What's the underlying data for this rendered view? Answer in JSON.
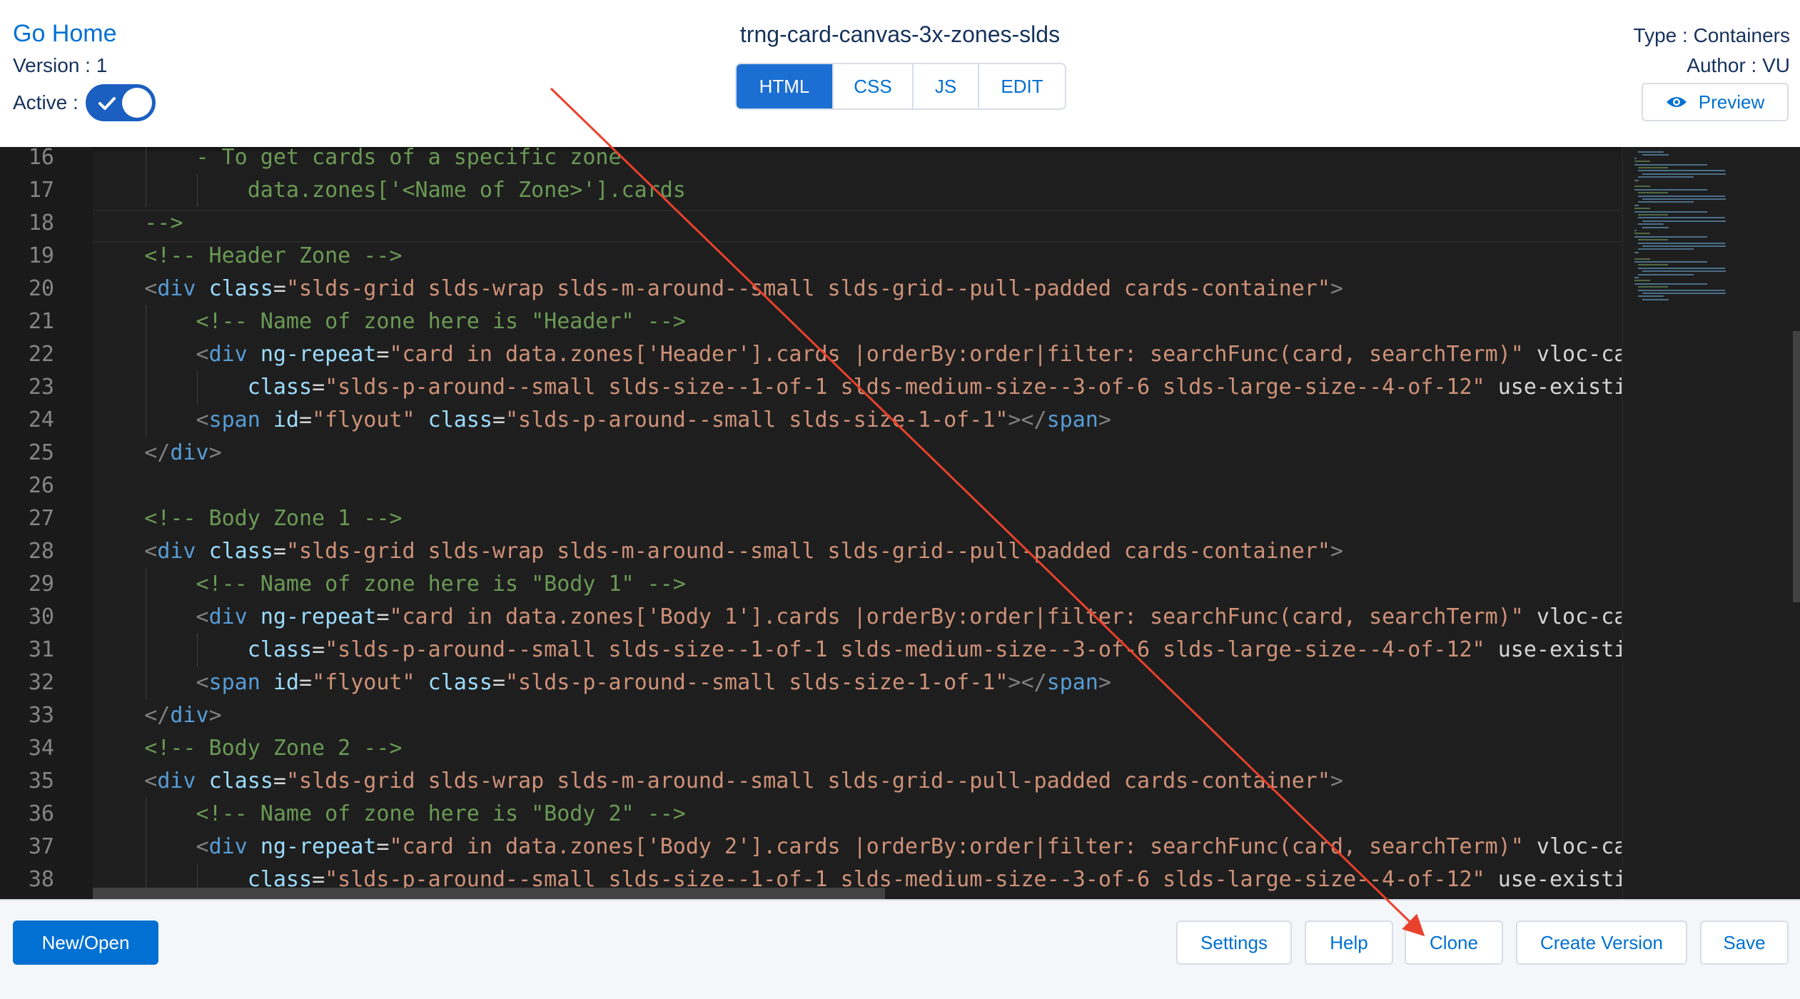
{
  "header": {
    "go_home": "Go Home",
    "version": "Version : 1",
    "active_label": "Active :",
    "active": true,
    "title": "trng-card-canvas-3x-zones-slds",
    "tabs": [
      {
        "label": "HTML",
        "selected": true
      },
      {
        "label": "CSS",
        "selected": false
      },
      {
        "label": "JS",
        "selected": false
      },
      {
        "label": "EDIT",
        "selected": false
      }
    ],
    "type": "Type : Containers",
    "author": "Author : VU",
    "preview_label": "Preview",
    "preview_icon": "eye-icon"
  },
  "editor": {
    "lines": [
      {
        "n": "16",
        "text": "        - To get cards of a specific zone"
      },
      {
        "n": "17",
        "text": "            data.zones['<Name of Zone>'].cards"
      },
      {
        "n": "18",
        "text": "    -->"
      },
      {
        "n": "19",
        "text": "    <!-- Header Zone -->"
      },
      {
        "n": "20",
        "text": "    <div class=\"slds-grid slds-wrap slds-m-around--small slds-grid--pull-padded cards-container\">"
      },
      {
        "n": "21",
        "text": "        <!-- Name of zone here is \"Header\" -->"
      },
      {
        "n": "22",
        "text": "        <div ng-repeat=\"card in data.zones['Header'].cards |orderBy:order|filter: searchFunc(card, searchTerm)\" vloc-ca"
      },
      {
        "n": "23",
        "text": "            class=\"slds-p-around--small slds-size--1-of-1 slds-medium-size--3-of-6 slds-large-size--4-of-12\" use-existi"
      },
      {
        "n": "24",
        "text": "        <span id=\"flyout\" class=\"slds-p-around--small slds-size-1-of-1\"></span>"
      },
      {
        "n": "25",
        "text": "    </div>"
      },
      {
        "n": "26",
        "text": ""
      },
      {
        "n": "27",
        "text": "    <!-- Body Zone 1 -->"
      },
      {
        "n": "28",
        "text": "    <div class=\"slds-grid slds-wrap slds-m-around--small slds-grid--pull-padded cards-container\">"
      },
      {
        "n": "29",
        "text": "        <!-- Name of zone here is \"Body 1\" -->"
      },
      {
        "n": "30",
        "text": "        <div ng-repeat=\"card in data.zones['Body 1'].cards |orderBy:order|filter: searchFunc(card, searchTerm)\" vloc-ca"
      },
      {
        "n": "31",
        "text": "            class=\"slds-p-around--small slds-size--1-of-1 slds-medium-size--3-of-6 slds-large-size--4-of-12\" use-existi"
      },
      {
        "n": "32",
        "text": "        <span id=\"flyout\" class=\"slds-p-around--small slds-size-1-of-1\"></span>"
      },
      {
        "n": "33",
        "text": "    </div>"
      },
      {
        "n": "34",
        "text": "    <!-- Body Zone 2 -->"
      },
      {
        "n": "35",
        "text": "    <div class=\"slds-grid slds-wrap slds-m-around--small slds-grid--pull-padded cards-container\">"
      },
      {
        "n": "36",
        "text": "        <!-- Name of zone here is \"Body 2\" -->"
      },
      {
        "n": "37",
        "text": "        <div ng-repeat=\"card in data.zones['Body 2'].cards |orderBy:order|filter: searchFunc(card, searchTerm)\" vloc-ca"
      },
      {
        "n": "38",
        "text": "            class=\"slds-p-around--small slds-size--1-of-1 slds-medium-size--3-of-6 slds-large-size--4-of-12\" use-existi"
      }
    ]
  },
  "footer": {
    "new_open": "New/Open",
    "settings": "Settings",
    "help": "Help",
    "clone": "Clone",
    "create_version": "Create Version",
    "save": "Save"
  },
  "colors": {
    "brand": "#0070d2",
    "editor_bg": "#1e1e1e",
    "annotation_arrow": "#e8412c"
  }
}
